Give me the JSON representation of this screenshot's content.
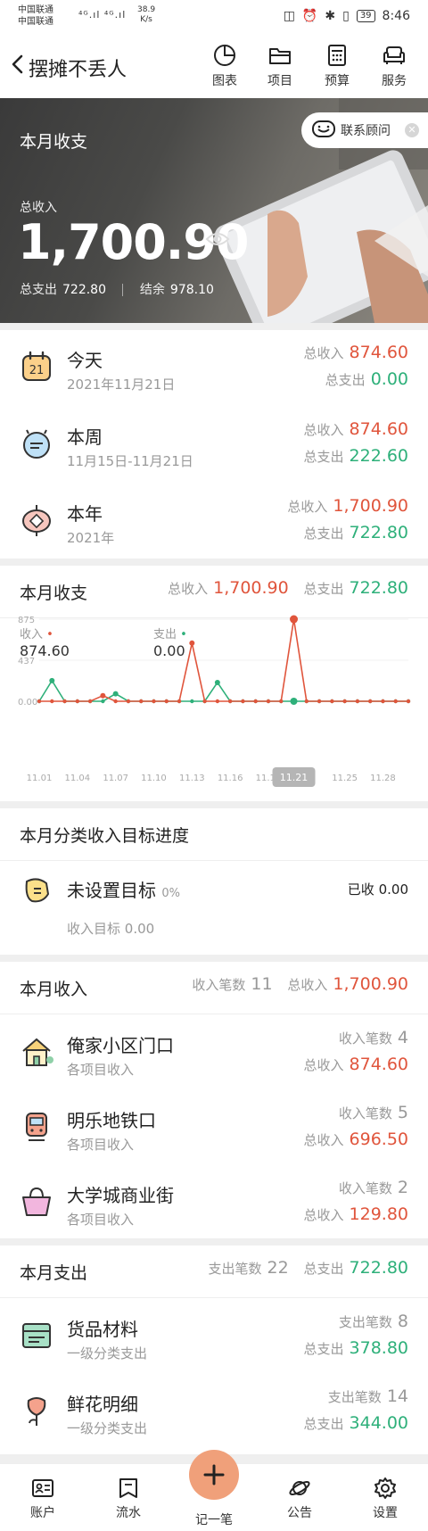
{
  "status_bar": {
    "carrier1": "中国联通",
    "carrier2": "中国联通",
    "signal": "⁴ᴳ.ıl ⁴ᴳ.ıl",
    "speed": "38.9",
    "speed_unit": "K/s",
    "battery": "39",
    "time": "8:46"
  },
  "header": {
    "title": "摆摊不丢人",
    "tools": [
      "图表",
      "项目",
      "预算",
      "服务"
    ]
  },
  "hero": {
    "title": "本月收支",
    "income_label": "总收入",
    "income_amount": "1,700.90",
    "expense_label": "总支出",
    "expense_amount": "722.80",
    "balance_label": "结余",
    "balance_amount": "978.10",
    "contact_label": "联系顾问"
  },
  "periods": [
    {
      "name": "今天",
      "sub": "2021年11月21日",
      "income_label": "总收入",
      "income": "874.60",
      "expense_label": "总支出",
      "expense": "0.00",
      "icon_num": "21"
    },
    {
      "name": "本周",
      "sub": "11月15日-11月21日",
      "income_label": "总收入",
      "income": "874.60",
      "expense_label": "总支出",
      "expense": "222.60"
    },
    {
      "name": "本年",
      "sub": "2021年",
      "income_label": "总收入",
      "income": "1,700.90",
      "expense_label": "总支出",
      "expense": "722.80"
    }
  ],
  "month_chart": {
    "title": "本月收支",
    "income_label": "总收入",
    "income_total": "1,700.90",
    "expense_label": "总支出",
    "expense_total": "722.80",
    "legend_income": "收入",
    "legend_income_value": "874.60",
    "legend_expense": "支出",
    "legend_expense_value": "0.00",
    "income_color": "#e0553c",
    "expense_color": "#2eb07a",
    "tooltip": "11.21"
  },
  "chart_data": {
    "type": "line",
    "x": [
      "11.01",
      "11.02",
      "11.03",
      "11.04",
      "11.05",
      "11.06",
      "11.07",
      "11.08",
      "11.09",
      "11.10",
      "11.11",
      "11.12",
      "11.13",
      "11.14",
      "11.15",
      "11.16",
      "11.17",
      "11.18",
      "11.19",
      "11.20",
      "11.21",
      "11.22",
      "11.23",
      "11.24",
      "11.25",
      "11.26",
      "11.27",
      "11.28",
      "11.29",
      "11.30"
    ],
    "x_tick_labels": [
      "11.01",
      "11.04",
      "11.07",
      "11.10",
      "11.13",
      "11.16",
      "11.19",
      "11.21",
      "11.25",
      "11.28"
    ],
    "y_tick_labels": [
      "875",
      "437",
      "0.00"
    ],
    "ylim": [
      0,
      875
    ],
    "series": [
      {
        "name": "收入",
        "values": [
          0,
          0,
          0,
          0,
          0,
          60,
          0,
          0,
          0,
          0,
          0,
          0,
          620,
          0,
          0,
          0,
          0,
          0,
          0,
          0,
          874.6,
          0,
          0,
          0,
          0,
          0,
          0,
          0,
          0,
          0
        ]
      },
      {
        "name": "支出",
        "values": [
          0,
          220,
          0,
          0,
          0,
          0,
          80,
          0,
          0,
          0,
          0,
          0,
          0,
          0,
          200,
          0,
          0,
          0,
          0,
          0,
          0,
          0,
          0,
          0,
          0,
          0,
          0,
          0,
          0,
          0
        ]
      }
    ]
  },
  "goal": {
    "title": "本月分类收入目标进度",
    "name": "未设置目标",
    "percent": "0%",
    "received_label": "已收",
    "received": "0.00",
    "target_label": "收入目标",
    "target": "0.00"
  },
  "month_income": {
    "title": "本月收入",
    "count_label": "收入笔数",
    "count": "11",
    "total_label": "总收入",
    "total": "1,700.90",
    "items": [
      {
        "name": "俺家小区门口",
        "sub": "各项目收入",
        "count_label": "收入笔数",
        "count": "4",
        "total_label": "总收入",
        "total": "874.60"
      },
      {
        "name": "明乐地铁口",
        "sub": "各项目收入",
        "count_label": "收入笔数",
        "count": "5",
        "total_label": "总收入",
        "total": "696.50"
      },
      {
        "name": "大学城商业街",
        "sub": "各项目收入",
        "count_label": "收入笔数",
        "count": "2",
        "total_label": "总收入",
        "total": "129.80"
      }
    ]
  },
  "month_expense": {
    "title": "本月支出",
    "count_label": "支出笔数",
    "count": "22",
    "total_label": "总支出",
    "total": "722.80",
    "items": [
      {
        "name": "货品材料",
        "sub": "一级分类支出",
        "count_label": "支出笔数",
        "count": "8",
        "total_label": "总支出",
        "total": "378.80"
      },
      {
        "name": "鲜花明细",
        "sub": "一级分类支出",
        "count_label": "支出笔数",
        "count": "14",
        "total_label": "总支出",
        "total": "344.00"
      }
    ]
  },
  "bottom_nav": [
    "账户",
    "流水",
    "记一笔",
    "公告",
    "设置"
  ]
}
